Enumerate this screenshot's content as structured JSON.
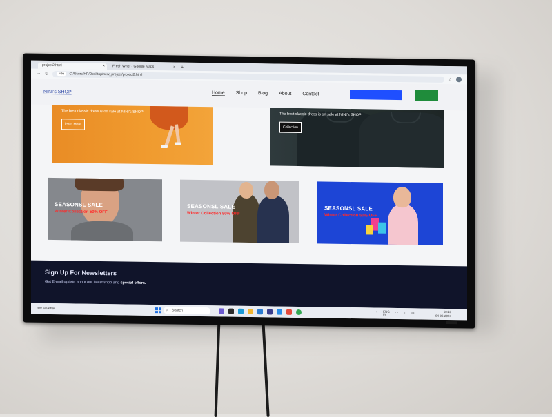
{
  "browser": {
    "tabs": [
      {
        "label": "project2.html",
        "active": true
      },
      {
        "label": "Fresh Wher - Google Maps",
        "active": false
      }
    ],
    "new_tab": "+",
    "address_prefix": "File",
    "address": "C:/Users/HP/Desktop/new_project/project2.html"
  },
  "site": {
    "brand": "NINI's SHOP",
    "nav": [
      "Home",
      "Shop",
      "Blog",
      "About",
      "Contact"
    ],
    "active_nav": "Home",
    "hero_left": {
      "text": "The best classic dress is on sale at NINI's SHOP",
      "button": "learn More"
    },
    "hero_right": {
      "text": "The best classic dress is on sale at NINI's SHOP",
      "button": "Collection"
    },
    "sale_cards": [
      {
        "title": "SEASONSL SALE",
        "subtitle": "Winter Collection 50% OFF"
      },
      {
        "title": "SEASONSL SALE",
        "subtitle": "Winter Collection 50% OFF"
      },
      {
        "title": "SEASONSL SALE",
        "subtitle": "Winter Collection 50% OFF"
      }
    ],
    "newsletter": {
      "title": "Sign Up For Newsletters",
      "subtitle_pre": "Get E-mail update about our latest shop and ",
      "subtitle_bold": "special offers."
    }
  },
  "taskbar": {
    "weather": "Hot weather",
    "search": "Search",
    "lang": "ENG",
    "lang2": "IN",
    "time": "10:18",
    "date": "04-06-2024"
  },
  "colors": {
    "accent_blue": "#1f4fff",
    "accent_green": "#1f8c3b",
    "sale_red": "#ff2a2a",
    "newsletter_bg": "#10142a"
  }
}
